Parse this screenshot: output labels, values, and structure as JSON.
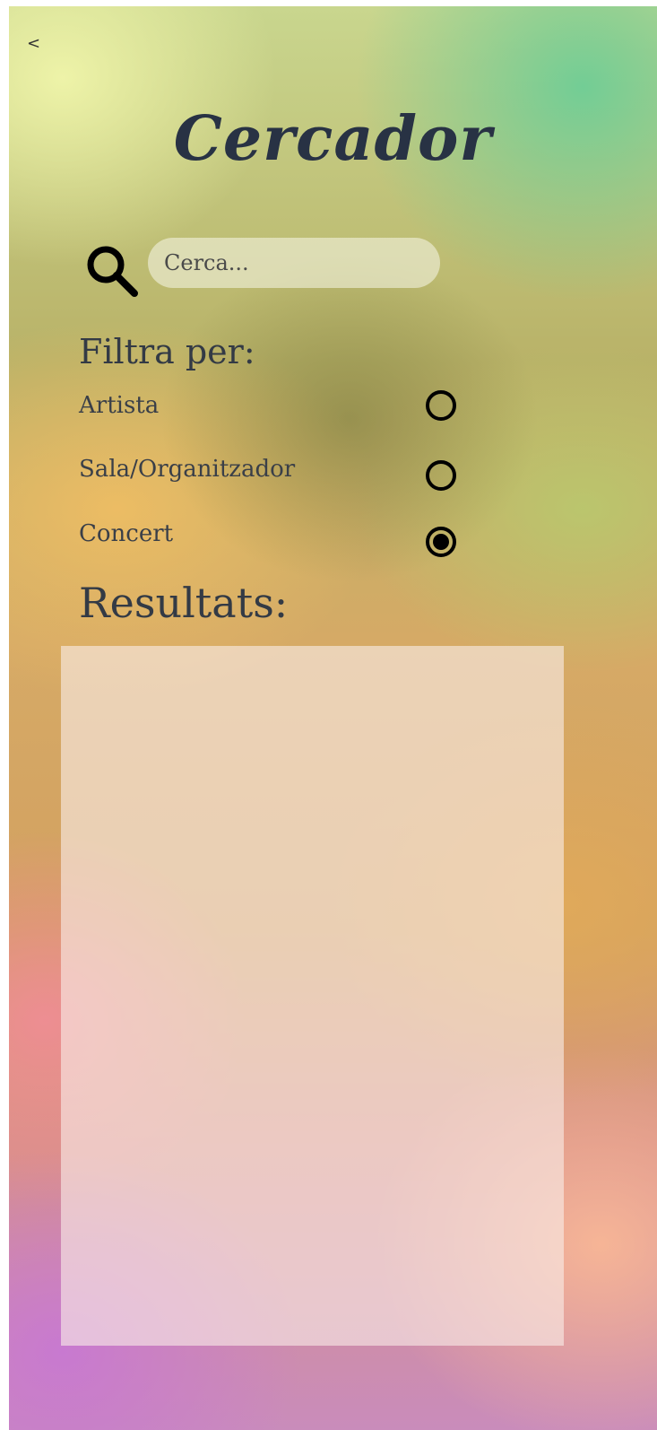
{
  "nav": {
    "back_label": "<"
  },
  "header": {
    "title": "Cercador"
  },
  "search": {
    "placeholder": "Cerca..."
  },
  "filters": {
    "heading": "Filtra per:",
    "options": [
      {
        "label": "Artista",
        "selected": false
      },
      {
        "label": "Sala/Organitzador",
        "selected": false
      },
      {
        "label": "Concert",
        "selected": true
      }
    ]
  },
  "results": {
    "heading": "Resultats:",
    "items": []
  },
  "icons": {
    "search": "search-icon"
  },
  "colors": {
    "title": "#283244",
    "text": "#333a45",
    "radio": "#000000"
  }
}
